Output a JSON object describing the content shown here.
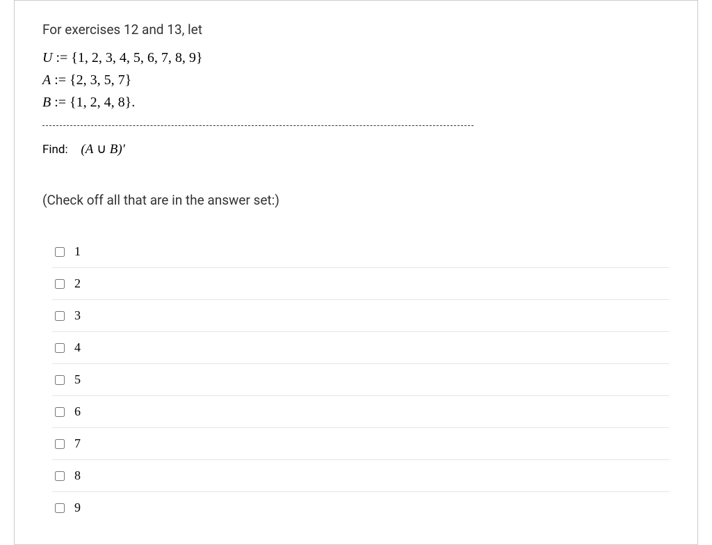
{
  "intro": "For exercises 12 and 13, let",
  "defs": {
    "U_var": "U",
    "U_val": " := {1, 2, 3, 4, 5, 6, 7, 8, 9}",
    "A_var": "A",
    "A_val": " := {2, 3, 5, 7}",
    "B_var": "B",
    "B_val": " := {1, 2, 4, 8}."
  },
  "find_label": "Find:",
  "find_expr_open": "(A",
  "find_expr_union": " ∪ ",
  "find_expr_close": "B)′",
  "check_instruction": "(Check off all that are in the answer set:)",
  "options": [
    "1",
    "2",
    "3",
    "4",
    "5",
    "6",
    "7",
    "8",
    "9"
  ]
}
